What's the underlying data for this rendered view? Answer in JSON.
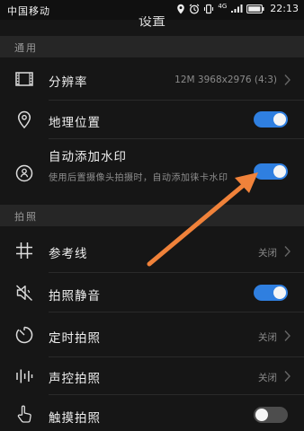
{
  "status_bar": {
    "carrier": "中国移动",
    "network": "4G",
    "time": "22:13"
  },
  "header": {
    "title": "设置"
  },
  "sections": {
    "general": "通用",
    "photo": "拍照"
  },
  "rows": {
    "resolution": {
      "label": "分辨率",
      "value": "12M 3968x2976 (4:3)"
    },
    "location": {
      "label": "地理位置",
      "enabled": true
    },
    "watermark": {
      "label": "自动添加水印",
      "description": "使用后置摄像头拍摄时，自动添加徕卡水印",
      "enabled": true
    },
    "grid": {
      "label": "参考线",
      "value": "关闭"
    },
    "mute": {
      "label": "拍照静音",
      "enabled": true
    },
    "timer": {
      "label": "定时拍照",
      "value": "关闭"
    },
    "audio": {
      "label": "声控拍照",
      "value": "关闭"
    },
    "touch": {
      "label": "触摸拍照",
      "enabled": false
    }
  },
  "colors": {
    "accent": "#2f7fe0",
    "annotation_arrow": "#f0823a"
  }
}
